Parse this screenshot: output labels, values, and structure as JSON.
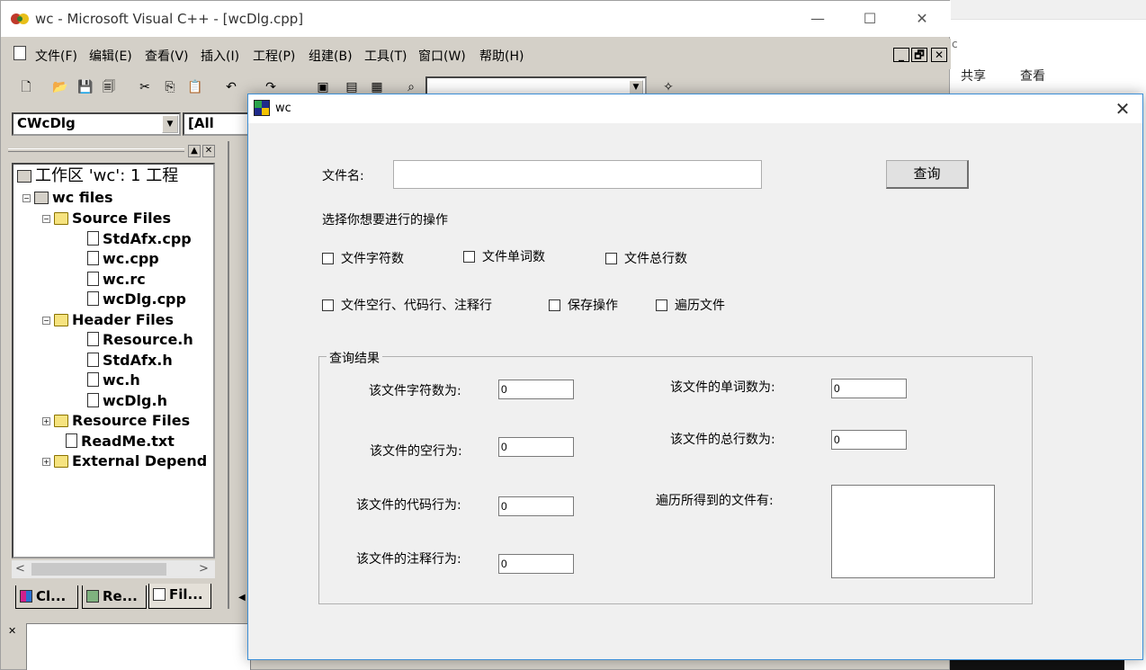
{
  "explorer": {
    "addr_hint": "c",
    "ribbon": [
      "共享",
      "查看"
    ]
  },
  "vc": {
    "title": "wc - Microsoft Visual C++ - [wcDlg.cpp]",
    "window_controls": {
      "minimize": "—",
      "maximize": "☐",
      "close": "✕"
    },
    "menu": [
      "文件(F)",
      "编辑(E)",
      "查看(V)",
      "插入(I)",
      "工程(P)",
      "组建(B)",
      "工具(T)",
      "窗口(W)",
      "帮助(H)"
    ],
    "mdi_controls": [
      "_",
      "🗗",
      "✕"
    ],
    "toolbar_icons": [
      "new-file",
      "open",
      "save",
      "save-all",
      "cut",
      "copy",
      "paste",
      "undo",
      "redo",
      "workspace",
      "output",
      "window-list",
      "find-in-files",
      "find-combo",
      "wizard"
    ],
    "class_combo": "CWcDlg",
    "member_combo": "[All class",
    "workspace": {
      "tree": [
        {
          "label": "工作区 'wc': 1 工程",
          "level": 0,
          "icon": "workspace"
        },
        {
          "label": "wc files",
          "level": 1,
          "icon": "project",
          "expander": "−"
        },
        {
          "label": "Source Files",
          "level": 2,
          "icon": "folder-open",
          "expander": "−"
        },
        {
          "label": "StdAfx.cpp",
          "level": 3,
          "icon": "cpp-file"
        },
        {
          "label": "wc.cpp",
          "level": 3,
          "icon": "cpp-file"
        },
        {
          "label": "wc.rc",
          "level": 3,
          "icon": "cpp-file"
        },
        {
          "label": "wcDlg.cpp",
          "level": 3,
          "icon": "cpp-file"
        },
        {
          "label": "Header Files",
          "level": 2,
          "icon": "folder-open",
          "expander": "−"
        },
        {
          "label": "Resource.h",
          "level": 3,
          "icon": "h-file"
        },
        {
          "label": "StdAfx.h",
          "level": 3,
          "icon": "h-file"
        },
        {
          "label": "wc.h",
          "level": 3,
          "icon": "h-file"
        },
        {
          "label": "wcDlg.h",
          "level": 3,
          "icon": "h-file"
        },
        {
          "label": "Resource Files",
          "level": 2,
          "icon": "folder",
          "expander": "+"
        },
        {
          "label": "ReadMe.txt",
          "level": 2,
          "icon": "txt-file"
        },
        {
          "label": "External Depend",
          "level": 2,
          "icon": "folder",
          "expander": "+"
        }
      ],
      "tabs": [
        "Cl...",
        "Re...",
        "Fil..."
      ]
    }
  },
  "dialog": {
    "title": "wc",
    "close": "✕",
    "filename_label": "文件名:",
    "filename_value": "",
    "query_button": "查询",
    "ops_label": "选择你想要进行的操作",
    "checks": [
      {
        "label": "文件字符数",
        "checked": false
      },
      {
        "label": "文件单词数",
        "checked": false
      },
      {
        "label": "文件总行数",
        "checked": false
      },
      {
        "label": "文件空行、代码行、注释行",
        "checked": false
      },
      {
        "label": "保存操作",
        "checked": false
      },
      {
        "label": "遍历文件",
        "checked": false
      }
    ],
    "results": {
      "legend": "查询结果",
      "char_label": "该文件字符数为:",
      "char_value": "0",
      "word_label": "该文件的单词数为:",
      "word_value": "0",
      "blank_label": "该文件的空行为:",
      "blank_value": "0",
      "total_label": "该文件的总行数为:",
      "total_value": "0",
      "code_label": "该文件的代码行为:",
      "code_value": "0",
      "comment_label": "该文件的注释行为:",
      "comment_value": "0",
      "traverse_label": "遍历所得到的文件有:"
    }
  }
}
